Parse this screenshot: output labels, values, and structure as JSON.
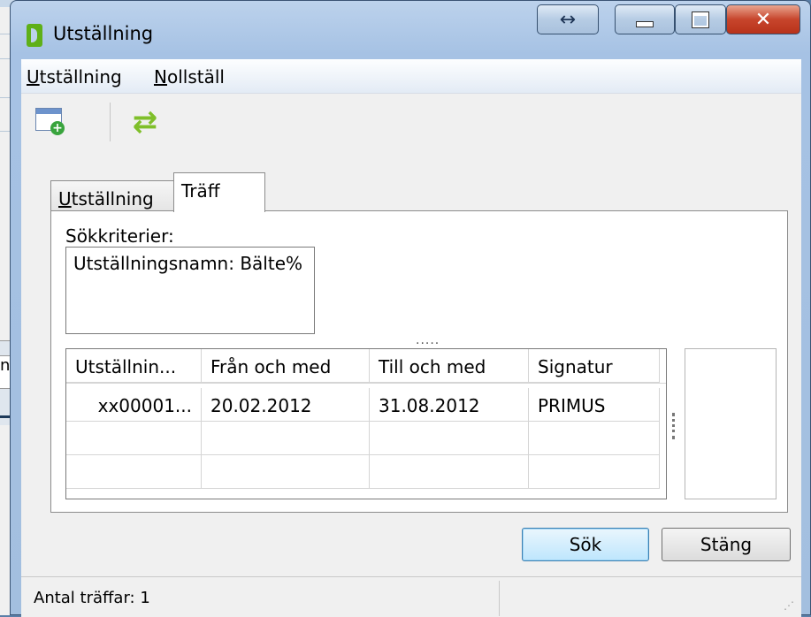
{
  "window": {
    "title": "Utställning"
  },
  "menu": {
    "items": [
      {
        "label": "Utställning",
        "mnemonic": "U",
        "rest": "tställning"
      },
      {
        "label": "Nollställ",
        "mnemonic": "N",
        "rest": "ollställ"
      }
    ]
  },
  "toolbar": {
    "new_icon": "new-window-icon",
    "refresh_icon": "refresh-icon"
  },
  "tabs": [
    {
      "label": "Utställning",
      "mnemonic": "U",
      "rest": "tställning"
    },
    {
      "label": "Träff"
    }
  ],
  "search": {
    "criteria_label": "Sökkriterier:",
    "criteria_value": "Utställningsnamn: Bälte%"
  },
  "grid": {
    "columns": [
      "Utställnin...",
      "Från och med",
      "Till och med",
      "Signatur"
    ],
    "rows": [
      [
        "xx00001...",
        "20.02.2012",
        "31.08.2012",
        "PRIMUS"
      ]
    ]
  },
  "buttons": {
    "search": "Sök",
    "close": "Stäng"
  },
  "status": {
    "hits": "Antal träffar: 1"
  },
  "background": {
    "fragment_text": "ng"
  },
  "colors": {
    "titlebar": "#a6c2e4",
    "close_button": "#c7452c",
    "accent_green": "#7fbf2a"
  }
}
